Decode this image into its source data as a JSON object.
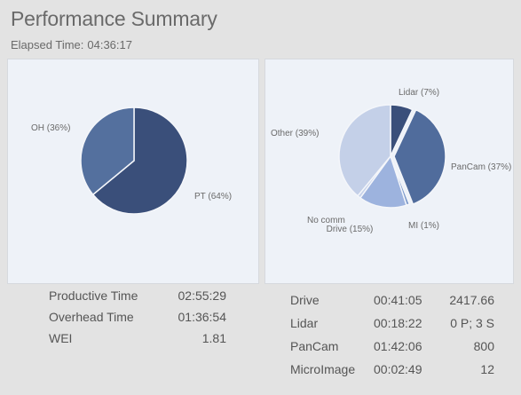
{
  "header": {
    "title": "Performance Summary",
    "elapsed_label": "Elapsed Time:",
    "elapsed_value": "04:36:17"
  },
  "chart_data": [
    {
      "type": "pie",
      "labels": [
        "PT (64%)",
        "OH (36%)"
      ],
      "values": [
        64,
        36
      ],
      "colors": [
        "#3a4f7a",
        "#54709e"
      ]
    },
    {
      "type": "pie",
      "labels": [
        "Lidar (7%)",
        "PanCam (37%)",
        "MI (1%)",
        "Drive (15%)",
        "No comm",
        "Other (39%)"
      ],
      "values": [
        7,
        37,
        1,
        15,
        1,
        39
      ],
      "colors": [
        "#3a4f7a",
        "#506c9c",
        "#7f9ccc",
        "#9db3de",
        "#c6d2ea",
        "#c4d0e8"
      ]
    }
  ],
  "stats_left": [
    {
      "label": "Productive Time",
      "value": "02:55:29"
    },
    {
      "label": "Overhead Time",
      "value": "01:36:54"
    },
    {
      "label": "WEI",
      "value": "1.81"
    }
  ],
  "stats_right": [
    {
      "label": "Drive",
      "time": "00:41:05",
      "value": "2417.66"
    },
    {
      "label": "Lidar",
      "time": "00:18:22",
      "value": "0 P; 3 S"
    },
    {
      "label": "PanCam",
      "time": "01:42:06",
      "value": "800"
    },
    {
      "label": "MicroImage",
      "time": "00:02:49",
      "value": "12"
    }
  ]
}
